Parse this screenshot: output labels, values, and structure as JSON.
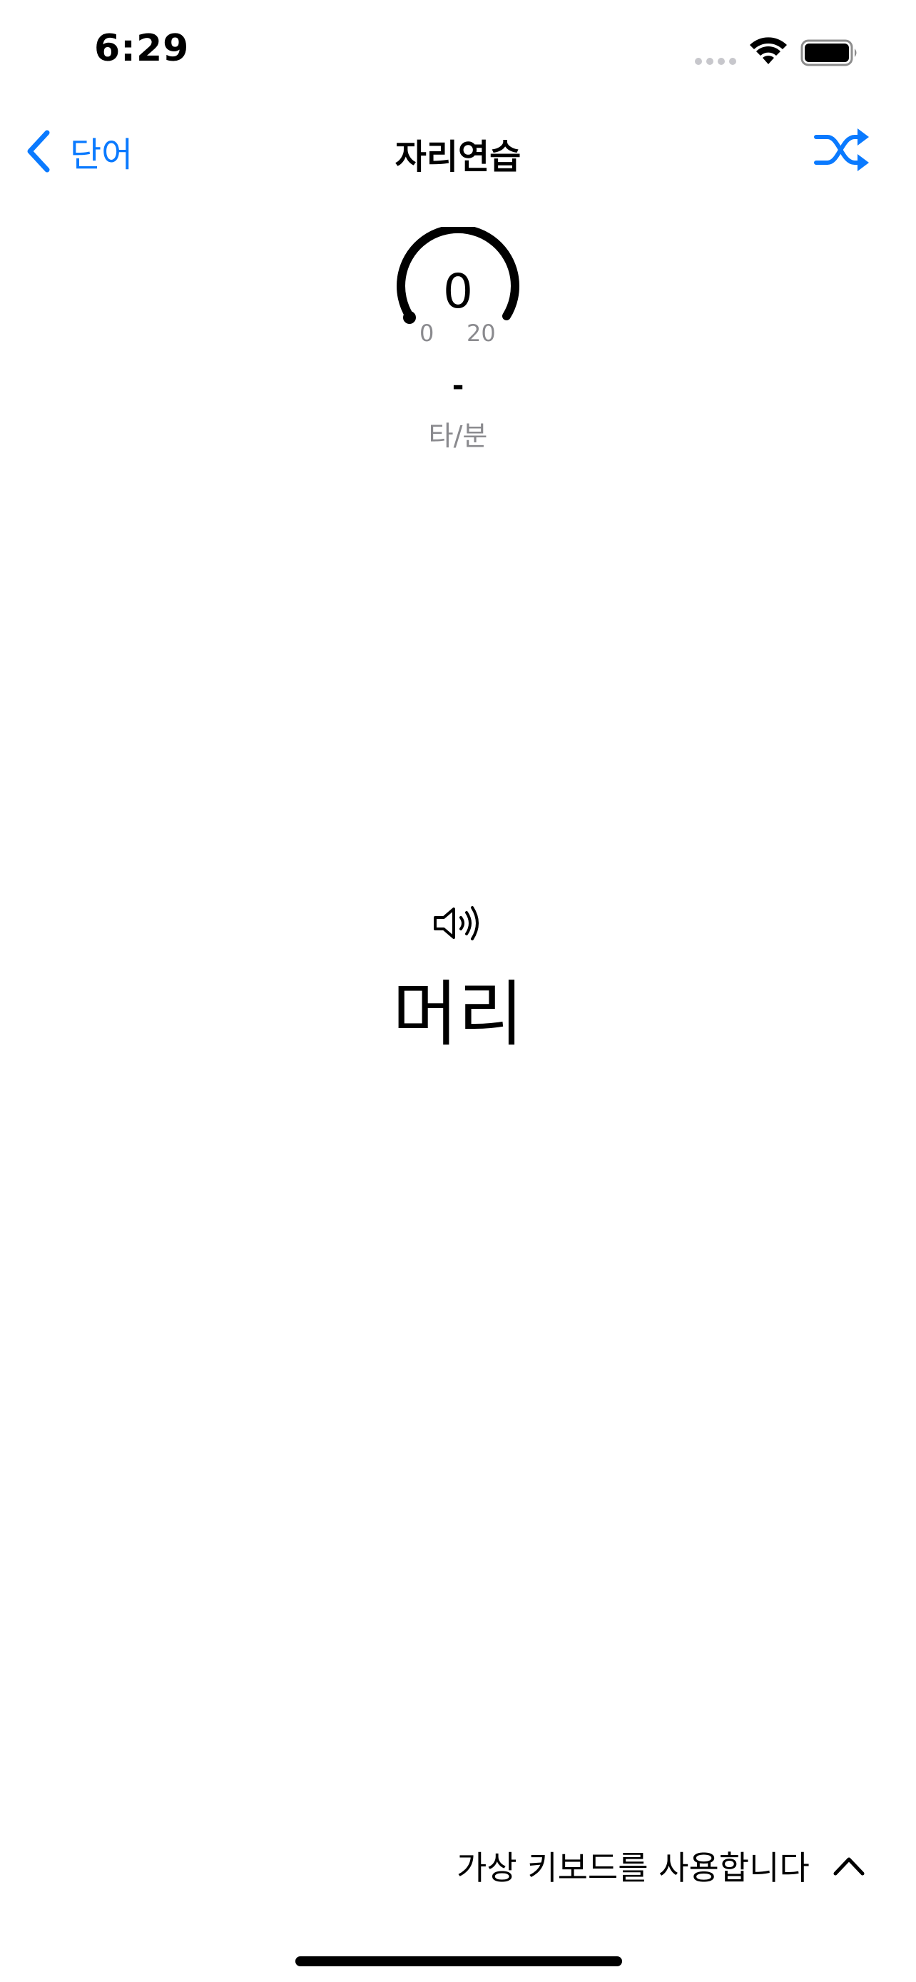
{
  "status_bar": {
    "time": "6:29"
  },
  "nav": {
    "back_label": "단어",
    "title": "자리연습",
    "back_icon": "chevron-left-icon",
    "shuffle_icon": "shuffle-icon",
    "accent_color": "#0a7aff"
  },
  "gauge": {
    "value": "0",
    "min_label": "0",
    "max_label": "20"
  },
  "speed": {
    "value": "-",
    "unit": "타/분"
  },
  "practice": {
    "speaker_icon": "speaker-wave-icon",
    "word": "머리"
  },
  "keyboard": {
    "label": "가상 키보드를 사용합니다",
    "icon": "chevron-up-icon"
  }
}
